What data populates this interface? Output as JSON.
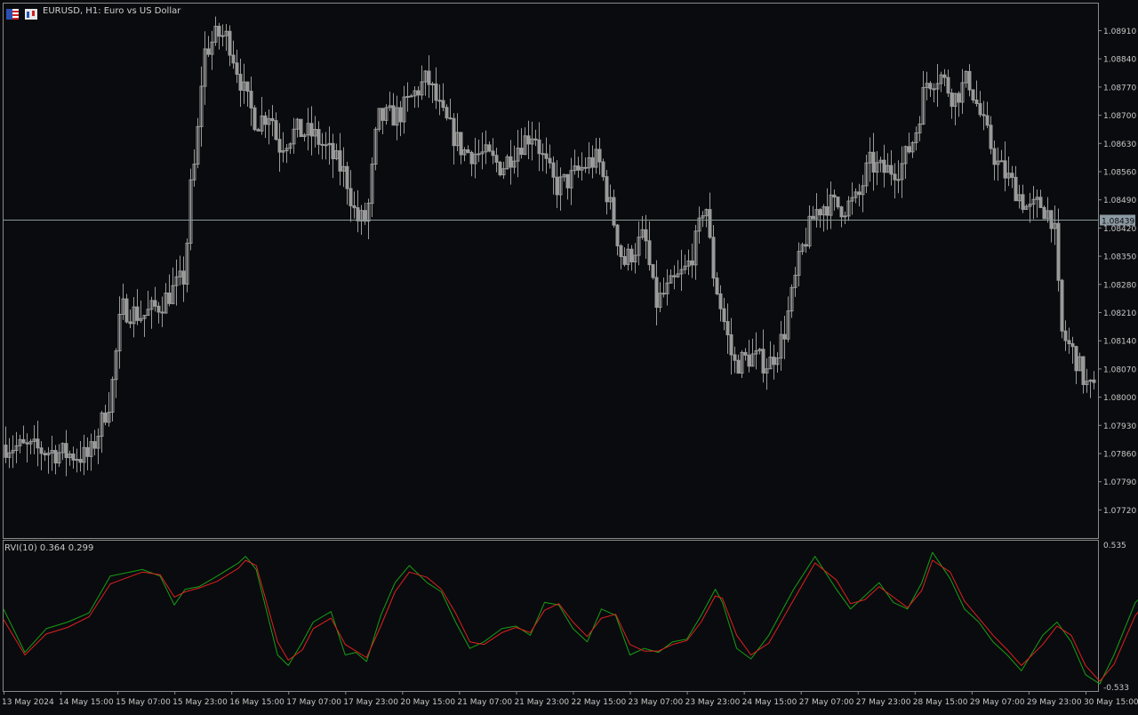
{
  "header": {
    "symbol": "EURUSD",
    "timeframe": "H1",
    "description": "Euro vs US Dollar",
    "title": "EURUSD, H1:  Euro vs US Dollar"
  },
  "colors": {
    "background": "#0a0b0e",
    "candle": "#9a9a9a",
    "frame": "#8a8a8a",
    "price_line": "#8a9a9a",
    "rvi": "#15a015",
    "signal": "#e02020",
    "text": "#c8c8c8"
  },
  "price_panel": {
    "price_ticks": [
      "1.08910",
      "1.08840",
      "1.08770",
      "1.08700",
      "1.08630",
      "1.08560",
      "1.08490",
      "1.08420",
      "1.08350",
      "1.08280",
      "1.08210",
      "1.08140",
      "1.08070",
      "1.08000",
      "1.07930",
      "1.07860",
      "1.07790",
      "1.07720"
    ],
    "current_price": "1.08439"
  },
  "indicator": {
    "name": "RVI(10)",
    "label": "RVI(10) 0.364 0.299",
    "rvi_value": "0.364",
    "signal_value": "0.299",
    "top_label": "0.535",
    "bottom_label": "-0.533"
  },
  "time_ticks": [
    "13 May 2024",
    "14 May 15:00",
    "15 May 07:00",
    "15 May 23:00",
    "16 May 15:00",
    "17 May 07:00",
    "17 May 23:00",
    "20 May 15:00",
    "21 May 07:00",
    "21 May 23:00",
    "22 May 15:00",
    "23 May 07:00",
    "23 May 23:00",
    "24 May 15:00",
    "27 May 07:00",
    "27 May 23:00",
    "28 May 15:00",
    "29 May 07:00",
    "29 May 23:00",
    "30 May 15:00"
  ],
  "chart_data": [
    {
      "type": "candlestick",
      "title": "EURUSD, H1:  Euro vs US Dollar",
      "ylim": [
        1.0769,
        1.0895
      ],
      "current_price": 1.08439,
      "close_path": [
        [
          "13 May 2024",
          1.0788
        ],
        [
          "14 May 00:00",
          1.0785
        ],
        [
          "14 May 06:00",
          1.08
        ],
        [
          "14 May 09:00",
          1.0822
        ],
        [
          "14 May 15:00",
          1.082
        ],
        [
          "14 May 20:00",
          1.0823
        ],
        [
          "15 May 00:00",
          1.0827
        ],
        [
          "15 May 03:00",
          1.083
        ],
        [
          "15 May 04:00",
          1.0849
        ],
        [
          "15 May 06:00",
          1.086
        ],
        [
          "15 May 08:00",
          1.0885
        ],
        [
          "15 May 12:00",
          1.089
        ],
        [
          "15 May 15:00",
          1.0889
        ],
        [
          "15 May 20:00",
          1.0874
        ],
        [
          "15 May 23:00",
          1.0868
        ],
        [
          "16 May 03:00",
          1.0871
        ],
        [
          "16 May 05:00",
          1.0862
        ],
        [
          "16 May 10:00",
          1.0866
        ],
        [
          "16 May 15:00",
          1.0865
        ],
        [
          "16 May 20:00",
          1.086
        ],
        [
          "17 May 00:00",
          1.0855
        ],
        [
          "17 May 03:00",
          1.0844
        ],
        [
          "17 May 06:00",
          1.0844
        ],
        [
          "17 May 09:00",
          1.0869
        ],
        [
          "17 May 15:00",
          1.087
        ],
        [
          "17 May 20:00",
          1.0876
        ],
        [
          "17 May 23:00",
          1.0879
        ],
        [
          "20 May 03:00",
          1.087
        ],
        [
          "20 May 09:00",
          1.0861
        ],
        [
          "20 May 15:00",
          1.086
        ],
        [
          "20 May 20:00",
          1.0857
        ],
        [
          "21 May 00:00",
          1.0862
        ],
        [
          "21 May 05:00",
          1.0866
        ],
        [
          "21 May 07:00",
          1.086
        ],
        [
          "21 May 11:00",
          1.0852
        ],
        [
          "21 May 15:00",
          1.0854
        ],
        [
          "21 May 20:00",
          1.0858
        ],
        [
          "21 May 23:00",
          1.0859
        ],
        [
          "22 May 03:00",
          1.0845
        ],
        [
          "22 May 06:00",
          1.0833
        ],
        [
          "22 May 12:00",
          1.084
        ],
        [
          "22 May 15:00",
          1.0823
        ],
        [
          "22 May 20:00",
          1.0828
        ],
        [
          "23 May 00:00",
          1.0832
        ],
        [
          "23 May 03:00",
          1.084
        ],
        [
          "23 May 05:00",
          1.085
        ],
        [
          "23 May 07:00",
          1.0832
        ],
        [
          "23 May 10:00",
          1.082
        ],
        [
          "23 May 13:00",
          1.0808
        ],
        [
          "23 May 18:00",
          1.081
        ],
        [
          "23 May 23:00",
          1.0808
        ],
        [
          "24 May 03:00",
          1.0815
        ],
        [
          "24 May 08:00",
          1.0836
        ],
        [
          "24 May 12:00",
          1.0846
        ],
        [
          "24 May 15:00",
          1.0848
        ],
        [
          "24 May 20:00",
          1.0847
        ],
        [
          "27 May 00:00",
          1.0849
        ],
        [
          "27 May 03:00",
          1.0858
        ],
        [
          "27 May 07:00",
          1.0856
        ],
        [
          "27 May 12:00",
          1.0857
        ],
        [
          "27 May 16:00",
          1.0865
        ],
        [
          "27 May 19:00",
          1.0878
        ],
        [
          "27 May 23:00",
          1.088
        ],
        [
          "28 May 03:00",
          1.0874
        ],
        [
          "28 May 07:00",
          1.0879
        ],
        [
          "28 May 11:00",
          1.0868
        ],
        [
          "28 May 15:00",
          1.0858
        ],
        [
          "28 May 20:00",
          1.0852
        ],
        [
          "29 May 00:00",
          1.0846
        ],
        [
          "29 May 03:00",
          1.0848
        ],
        [
          "29 May 07:00",
          1.0844
        ],
        [
          "29 May 09:00",
          1.0816
        ],
        [
          "29 May 13:00",
          1.081
        ],
        [
          "29 May 16:00",
          1.0803
        ],
        [
          "29 May 20:00",
          1.08
        ],
        [
          "29 May 23:00",
          1.0795
        ],
        [
          "30 May 02:00",
          1.081
        ],
        [
          "30 May 06:00",
          1.0816
        ],
        [
          "30 May 09:00",
          1.0827
        ],
        [
          "30 May 12:00",
          1.0844
        ]
      ]
    },
    {
      "type": "line",
      "title": "RVI(10) 0.364 0.299",
      "ylim": [
        -0.533,
        0.535
      ],
      "series": [
        {
          "name": "RVI(10)",
          "last": 0.364,
          "path": [
            [
              "13 May 2024",
              0.05
            ],
            [
              "13 May 06:00",
              -0.28
            ],
            [
              "13 May 12:00",
              -0.1
            ],
            [
              "13 May 18:00",
              -0.05
            ],
            [
              "14 May 00:00",
              0.02
            ],
            [
              "14 May 06:00",
              0.3
            ],
            [
              "14 May 15:00",
              0.35
            ],
            [
              "14 May 20:00",
              0.3
            ],
            [
              "15 May 00:00",
              0.08
            ],
            [
              "15 May 03:00",
              0.2
            ],
            [
              "15 May 07:00",
              0.22
            ],
            [
              "15 May 12:00",
              0.3
            ],
            [
              "15 May 18:00",
              0.4
            ],
            [
              "15 May 20:00",
              0.45
            ],
            [
              "15 May 23:00",
              0.35
            ],
            [
              "16 May 05:00",
              -0.3
            ],
            [
              "16 May 08:00",
              -0.38
            ],
            [
              "16 May 12:00",
              -0.2
            ],
            [
              "16 May 15:00",
              -0.05
            ],
            [
              "16 May 20:00",
              0.03
            ],
            [
              "17 May 00:00",
              -0.3
            ],
            [
              "17 May 03:00",
              -0.28
            ],
            [
              "17 May 06:00",
              -0.35
            ],
            [
              "17 May 10:00",
              0.0
            ],
            [
              "17 May 14:00",
              0.25
            ],
            [
              "17 May 18:00",
              0.38
            ],
            [
              "17 May 23:00",
              0.25
            ],
            [
              "20 May 03:00",
              0.18
            ],
            [
              "20 May 07:00",
              -0.05
            ],
            [
              "20 May 11:00",
              -0.25
            ],
            [
              "20 May 15:00",
              -0.2
            ],
            [
              "20 May 20:00",
              -0.1
            ],
            [
              "21 May 00:00",
              -0.08
            ],
            [
              "21 May 04:00",
              -0.15
            ],
            [
              "21 May 08:00",
              0.1
            ],
            [
              "21 May 12:00",
              0.08
            ],
            [
              "21 May 16:00",
              -0.1
            ],
            [
              "21 May 20:00",
              -0.2
            ],
            [
              "22 May 00:00",
              0.05
            ],
            [
              "22 May 04:00",
              0.0
            ],
            [
              "22 May 08:00",
              -0.3
            ],
            [
              "22 May 12:00",
              -0.25
            ],
            [
              "22 May 16:00",
              -0.28
            ],
            [
              "22 May 20:00",
              -0.2
            ],
            [
              "23 May 00:00",
              -0.18
            ],
            [
              "23 May 04:00",
              0.0
            ],
            [
              "23 May 08:00",
              0.2
            ],
            [
              "23 May 10:00",
              0.1
            ],
            [
              "23 May 14:00",
              -0.25
            ],
            [
              "23 May 18:00",
              -0.33
            ],
            [
              "23 May 23:00",
              -0.15
            ],
            [
              "24 May 06:00",
              0.2
            ],
            [
              "24 May 12:00",
              0.45
            ],
            [
              "24 May 18:00",
              0.2
            ],
            [
              "24 May 22:00",
              0.05
            ],
            [
              "27 May 02:00",
              0.15
            ],
            [
              "27 May 06:00",
              0.25
            ],
            [
              "27 May 10:00",
              0.1
            ],
            [
              "27 May 14:00",
              0.05
            ],
            [
              "27 May 18:00",
              0.25
            ],
            [
              "27 May 21:00",
              0.48
            ],
            [
              "28 May 02:00",
              0.28
            ],
            [
              "28 May 06:00",
              0.05
            ],
            [
              "28 May 10:00",
              -0.05
            ],
            [
              "28 May 14:00",
              -0.2
            ],
            [
              "28 May 18:00",
              -0.3
            ],
            [
              "28 May 22:00",
              -0.42
            ],
            [
              "29 May 04:00",
              -0.15
            ],
            [
              "29 May 08:00",
              -0.05
            ],
            [
              "29 May 12:00",
              -0.2
            ],
            [
              "29 May 16:00",
              -0.45
            ],
            [
              "29 May 20:00",
              -0.52
            ],
            [
              "30 May 00:00",
              -0.3
            ],
            [
              "30 May 06:00",
              0.1
            ],
            [
              "30 May 12:00",
              0.25
            ],
            [
              "30 May 15:00",
              0.36
            ]
          ]
        },
        {
          "name": "signal",
          "last": 0.299,
          "path": [
            [
              "13 May 2024",
              -0.03
            ],
            [
              "13 May 06:00",
              -0.3
            ],
            [
              "13 May 12:00",
              -0.14
            ],
            [
              "13 May 18:00",
              -0.09
            ],
            [
              "14 May 00:00",
              -0.01
            ],
            [
              "14 May 06:00",
              0.24
            ],
            [
              "14 May 15:00",
              0.33
            ],
            [
              "14 May 20:00",
              0.31
            ],
            [
              "15 May 00:00",
              0.14
            ],
            [
              "15 May 03:00",
              0.18
            ],
            [
              "15 May 07:00",
              0.21
            ],
            [
              "15 May 12:00",
              0.26
            ],
            [
              "15 May 18:00",
              0.36
            ],
            [
              "15 May 20:00",
              0.42
            ],
            [
              "15 May 23:00",
              0.38
            ],
            [
              "16 May 05:00",
              -0.2
            ],
            [
              "16 May 08:00",
              -0.34
            ],
            [
              "16 May 12:00",
              -0.26
            ],
            [
              "16 May 15:00",
              -0.1
            ],
            [
              "16 May 20:00",
              -0.02
            ],
            [
              "17 May 00:00",
              -0.22
            ],
            [
              "17 May 03:00",
              -0.27
            ],
            [
              "17 May 06:00",
              -0.32
            ],
            [
              "17 May 10:00",
              -0.08
            ],
            [
              "17 May 14:00",
              0.18
            ],
            [
              "17 May 18:00",
              0.33
            ],
            [
              "17 May 23:00",
              0.29
            ],
            [
              "20 May 03:00",
              0.2
            ],
            [
              "20 May 07:00",
              0.02
            ],
            [
              "20 May 11:00",
              -0.2
            ],
            [
              "20 May 15:00",
              -0.22
            ],
            [
              "20 May 20:00",
              -0.13
            ],
            [
              "21 May 00:00",
              -0.09
            ],
            [
              "21 May 04:00",
              -0.13
            ],
            [
              "21 May 08:00",
              0.04
            ],
            [
              "21 May 12:00",
              0.09
            ],
            [
              "21 May 16:00",
              -0.05
            ],
            [
              "21 May 20:00",
              -0.16
            ],
            [
              "22 May 00:00",
              -0.02
            ],
            [
              "22 May 04:00",
              0.01
            ],
            [
              "22 May 08:00",
              -0.22
            ],
            [
              "22 May 12:00",
              -0.27
            ],
            [
              "22 May 16:00",
              -0.27
            ],
            [
              "22 May 20:00",
              -0.22
            ],
            [
              "23 May 00:00",
              -0.19
            ],
            [
              "23 May 04:00",
              -0.05
            ],
            [
              "23 May 08:00",
              0.15
            ],
            [
              "23 May 10:00",
              0.13
            ],
            [
              "23 May 14:00",
              -0.15
            ],
            [
              "23 May 18:00",
              -0.3
            ],
            [
              "23 May 23:00",
              -0.21
            ],
            [
              "24 May 06:00",
              0.12
            ],
            [
              "24 May 12:00",
              0.4
            ],
            [
              "24 May 18:00",
              0.27
            ],
            [
              "24 May 22:00",
              0.09
            ],
            [
              "27 May 02:00",
              0.12
            ],
            [
              "27 May 06:00",
              0.22
            ],
            [
              "27 May 10:00",
              0.14
            ],
            [
              "27 May 14:00",
              0.06
            ],
            [
              "27 May 18:00",
              0.19
            ],
            [
              "27 May 21:00",
              0.42
            ],
            [
              "28 May 02:00",
              0.33
            ],
            [
              "28 May 06:00",
              0.11
            ],
            [
              "28 May 10:00",
              -0.02
            ],
            [
              "28 May 14:00",
              -0.15
            ],
            [
              "28 May 18:00",
              -0.26
            ],
            [
              "28 May 22:00",
              -0.38
            ],
            [
              "29 May 04:00",
              -0.22
            ],
            [
              "29 May 08:00",
              -0.08
            ],
            [
              "29 May 12:00",
              -0.15
            ],
            [
              "29 May 16:00",
              -0.38
            ],
            [
              "29 May 20:00",
              -0.5
            ],
            [
              "30 May 00:00",
              -0.37
            ],
            [
              "30 May 06:00",
              0.0
            ],
            [
              "30 May 12:00",
              0.2
            ],
            [
              "30 May 15:00",
              0.3
            ]
          ]
        }
      ]
    }
  ]
}
